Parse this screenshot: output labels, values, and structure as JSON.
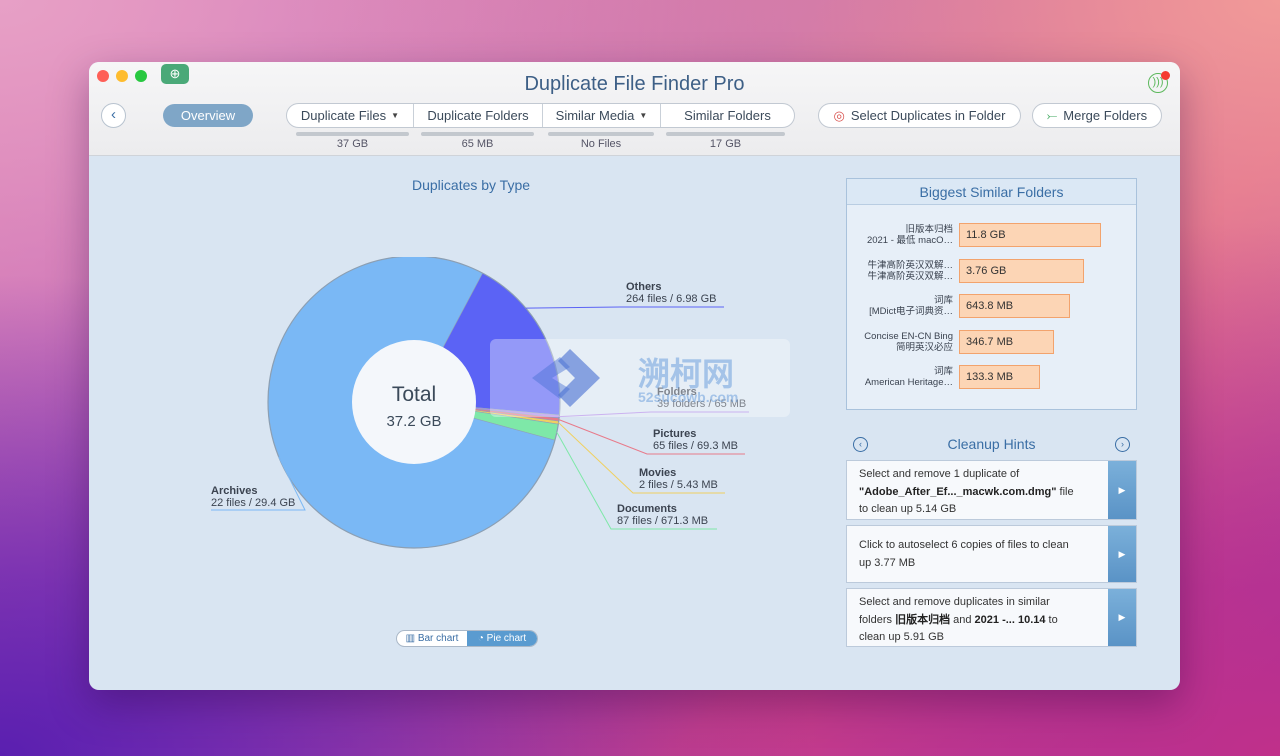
{
  "window": {
    "title": "Duplicate File Finder Pro"
  },
  "toolbar": {
    "overview_label": "Overview",
    "tabs": [
      {
        "label": "Duplicate Files",
        "size": "37 GB",
        "has_dropdown": true
      },
      {
        "label": "Duplicate Folders",
        "size": "65 MB",
        "has_dropdown": false
      },
      {
        "label": "Similar Media",
        "size": "No Files",
        "has_dropdown": true
      },
      {
        "label": "Similar Folders",
        "size": "17 GB",
        "has_dropdown": false
      }
    ],
    "select_duplicates_label": "Select Duplicates in Folder",
    "merge_folders_label": "Merge Folders"
  },
  "chart_title": "Duplicates by Type",
  "chart_data": {
    "type": "pie",
    "title": "Duplicates by Type",
    "center_label": "Total",
    "center_value": "37.2 GB",
    "slices": [
      {
        "name": "Archives",
        "detail": "22 files / 29.4 GB",
        "value_gb": 29.4,
        "color": "#7ab8f5"
      },
      {
        "name": "Others",
        "detail": "264 files / 6.98 GB",
        "value_gb": 6.98,
        "color": "#5b63f5"
      },
      {
        "name": "Folders",
        "detail": "39 folders / 65 MB",
        "value_gb": 0.065,
        "color": "#b08ae8"
      },
      {
        "name": "Pictures",
        "detail": "65 files / 69.3 MB",
        "value_gb": 0.0693,
        "color": "#e87a8a"
      },
      {
        "name": "Movies",
        "detail": "2 files / 5.43 MB",
        "value_gb": 0.00543,
        "color": "#f0d060"
      },
      {
        "name": "Documents",
        "detail": "87 files / 671.3 MB",
        "value_gb": 0.6713,
        "color": "#7ee8a8"
      }
    ]
  },
  "chart_toggle": {
    "bar_label": "Bar chart",
    "pie_label": "Pie chart",
    "active": "pie"
  },
  "biggest_folders": {
    "title": "Biggest Similar Folders",
    "items": [
      {
        "name1": "旧版本归档",
        "name2": "2021 - 最低 macO…",
        "size": "11.8 GB",
        "fraction": 1.0
      },
      {
        "name1": "牛津高阶英汉双解…",
        "name2": "牛津高阶英汉双解…",
        "size": "3.76 GB",
        "fraction": 0.88
      },
      {
        "name1": "词库",
        "name2": "[MDict电子词典资…",
        "size": "643.8 MB",
        "fraction": 0.78
      },
      {
        "name1": "Concise EN-CN Bing",
        "name2": "简明英汉必应",
        "size": "346.7 MB",
        "fraction": 0.67
      },
      {
        "name1": "词库",
        "name2": "American Heritage…",
        "size": "133.3 MB",
        "fraction": 0.57
      }
    ]
  },
  "cleanup_hints": {
    "title": "Cleanup Hints",
    "hint1": {
      "a": "Select and remove 1 duplicate of",
      "b": "\"Adobe_After_Ef..._macwk.com.dmg\"",
      "c": " file",
      "d": "to clean up 5.14 GB"
    },
    "hint2": {
      "a": "Click to autoselect 6 copies of files to clean",
      "b": "up 3.77 MB"
    },
    "hint3": {
      "a": "Select and remove duplicates in similar",
      "b": "folders ",
      "c": "旧版本归档",
      "d": " and ",
      "e": "2021 -... 10.14",
      "f": " to",
      "g": "clean up 5.91 GB"
    }
  },
  "watermark": {
    "text1": "溯柯网",
    "text2": "52sucowb.com"
  }
}
